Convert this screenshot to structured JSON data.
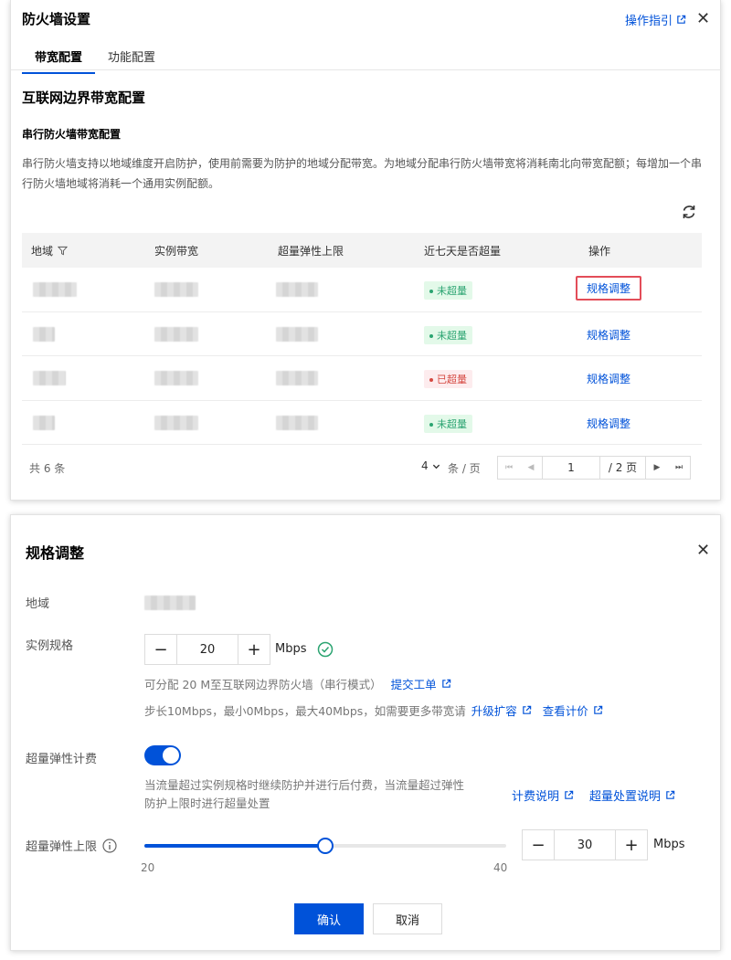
{
  "firewall_panel": {
    "title": "防火墙设置",
    "guide_link": "操作指引",
    "tabs": [
      {
        "label": "带宽配置",
        "active": true
      },
      {
        "label": "功能配置",
        "active": false
      }
    ],
    "section_title": "互联网边界带宽配置",
    "sub_title": "串行防火墙带宽配置",
    "description": "串行防火墙支持以地域维度开启防护，使用前需要为防护的地域分配带宽。为地域分配串行防火墙带宽将消耗南北向带宽配额；每增加一个串行防火墙地域将消耗一个通用实例配额。",
    "table": {
      "headers": [
        "地域",
        "实例带宽",
        "超量弹性上限",
        "近七天是否超量",
        "操作"
      ],
      "rows": [
        {
          "status": "未超量",
          "status_type": "ok",
          "action": "规格调整",
          "highlighted": true
        },
        {
          "status": "未超量",
          "status_type": "ok",
          "action": "规格调整",
          "highlighted": false
        },
        {
          "status": "已超量",
          "status_type": "bad",
          "action": "规格调整",
          "highlighted": false
        },
        {
          "status": "未超量",
          "status_type": "ok",
          "action": "规格调整",
          "highlighted": false
        }
      ]
    },
    "pagination": {
      "total": "共 6 条",
      "page_size": "4",
      "per_page_label": "条 / 页",
      "current_page": "1",
      "total_pages": "/ 2 页"
    }
  },
  "spec_panel": {
    "title": "规格调整",
    "region_label": "地域",
    "instance_spec_label": "实例规格",
    "instance_spec_value": "20",
    "unit": "Mbps",
    "alloc_hint": "可分配 20 M至互联网边界防火墙（串行模式）",
    "submit_ticket": "提交工单",
    "step_hint": "步长10Mbps，最小0Mbps，最大40Mbps，如需要更多带宽请",
    "upgrade_link": "升级扩容",
    "pricing_link": "查看计价",
    "elastic_billing_label": "超量弹性计费",
    "elastic_billing_enabled": true,
    "elastic_hint_line1": "当流量超过实例规格时继续防护并进行后付费，当流量超过弹性",
    "elastic_hint_line2": "防护上限时进行超量处置",
    "billing_doc_link": "计费说明",
    "overflow_doc_link": "超量处置说明",
    "elastic_limit_label": "超量弹性上限",
    "slider_min": "20",
    "slider_max": "40",
    "slider_value": 30,
    "elastic_limit_value": "30",
    "confirm": "确认",
    "cancel": "取消"
  },
  "colors": {
    "primary": "#0052d9",
    "ok": "#2ba471",
    "bad": "#d54941",
    "highlight_border": "#e34d59"
  }
}
